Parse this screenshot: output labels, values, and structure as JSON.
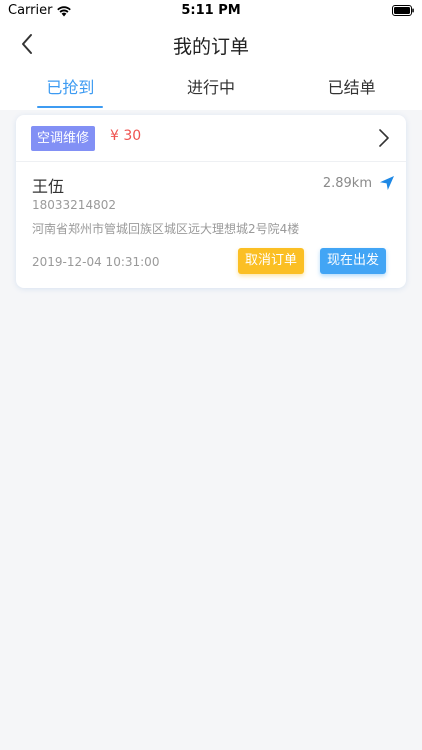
{
  "status_bar": {
    "carrier": "Carrier",
    "time": "5:11 PM"
  },
  "nav": {
    "title": "我的订单",
    "back_icon": "chevron-left-icon"
  },
  "tabs": [
    {
      "label": "已抢到",
      "active": true
    },
    {
      "label": "进行中",
      "active": false
    },
    {
      "label": "已结单",
      "active": false
    }
  ],
  "order": {
    "service_type": "空调维修",
    "price": "¥ 30",
    "customer_name": "王伍",
    "distance": "2.89km",
    "phone": "18033214802",
    "address": "河南省郑州市管城回族区城区远大理想城2号院4楼",
    "datetime": "2019-12-04 10:31:00",
    "cancel_label": "取消订单",
    "depart_label": "现在出发"
  },
  "colors": {
    "accent": "#3d9bf2",
    "tag": "#8290f5",
    "price": "#ef5350",
    "cancel_button": "#fbbf24",
    "depart_button": "#42a5f5",
    "background": "#f5f6f8"
  }
}
